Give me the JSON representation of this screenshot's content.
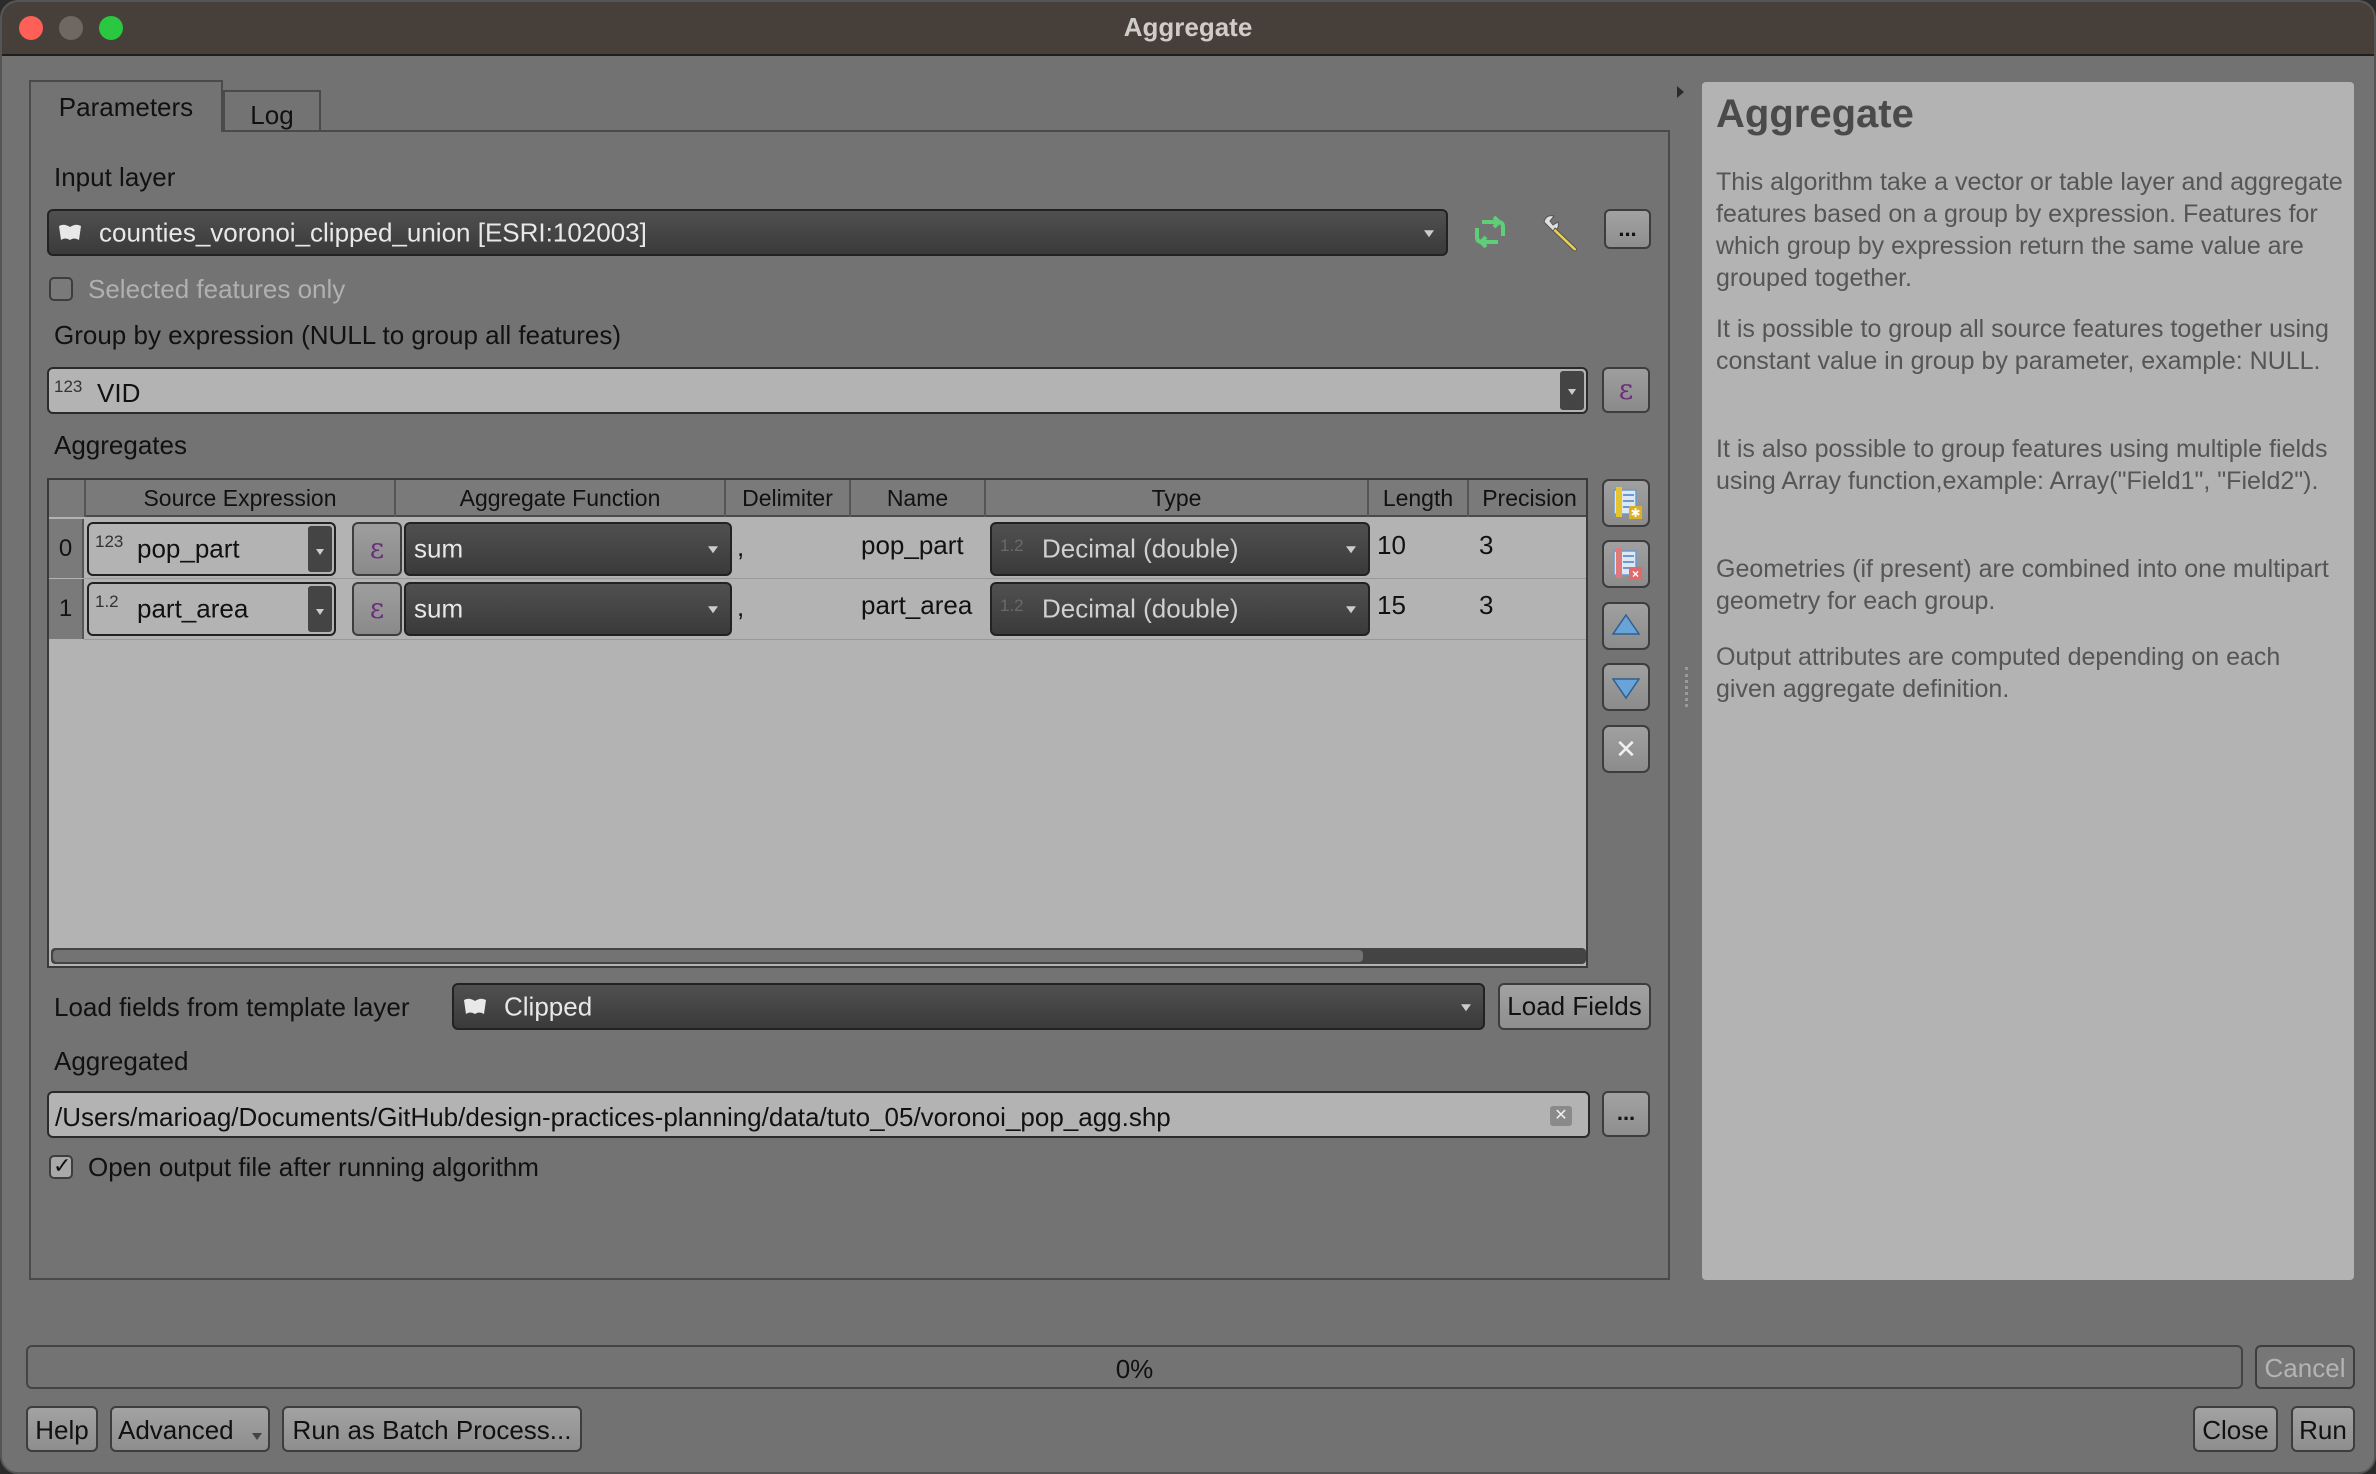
{
  "window": {
    "title": "Aggregate"
  },
  "tabs": [
    {
      "label": "Parameters",
      "active": true
    },
    {
      "label": "Log",
      "active": false
    }
  ],
  "params": {
    "input_layer_label": "Input layer",
    "input_layer_value": "counties_voronoi_clipped_union [ESRI:102003]",
    "selected_only_label": "Selected features only",
    "selected_only_checked": false,
    "group_by_label": "Group by expression (NULL to group all features)",
    "group_by_type_badge": "123",
    "group_by_value": "VID",
    "aggregates_label": "Aggregates",
    "load_fields_label": "Load fields from template layer",
    "template_layer_value": "Clipped",
    "load_fields_button": "Load Fields",
    "aggregated_label": "Aggregated",
    "output_path": "/Users/marioag/Documents/GitHub/design-practices-planning/data/tuto_05/voronoi_pop_agg.shp",
    "open_output_label": "Open output file after running algorithm",
    "open_output_checked": true,
    "browse_label": "..."
  },
  "table": {
    "columns": [
      "Source Expression",
      "Aggregate Function",
      "Delimiter",
      "Name",
      "Type",
      "Length",
      "Precision"
    ],
    "rows": [
      {
        "index": "0",
        "source_badge": "123",
        "source": "pop_part",
        "function": "sum",
        "delimiter": ",",
        "name": "pop_part",
        "type_badge": "1.2",
        "type": "Decimal (double)",
        "length": "10",
        "precision": "3"
      },
      {
        "index": "1",
        "source_badge": "1.2",
        "source": "part_area",
        "function": "sum",
        "delimiter": ",",
        "name": "part_area",
        "type_badge": "1.2",
        "type": "Decimal (double)",
        "length": "15",
        "precision": "3"
      }
    ],
    "expression_symbol": "ε"
  },
  "side_buttons": [
    "add-field-icon",
    "delete-field-icon",
    "move-up-icon",
    "move-down-icon",
    "clear-icon"
  ],
  "help": {
    "title": "Aggregate",
    "paragraphs": [
      "This algorithm take a vector or table layer and aggregate features based on a group by expression. Features for which group by expression return the same value are grouped together.",
      "It is possible to group all source features together using constant value in group by parameter, example: NULL.",
      "It is also possible to group features using multiple fields using Array function,example: Array(\"Field1\", \"Field2\").",
      "Geometries (if present) are combined into one multipart geometry for each group.",
      "Output attributes are computed depending on each given aggregate definition."
    ]
  },
  "progress": {
    "value_percent": 0,
    "text": "0%"
  },
  "buttons": {
    "cancel": "Cancel",
    "help": "Help",
    "advanced": "Advanced",
    "batch": "Run as Batch Process...",
    "close": "Close",
    "run": "Run"
  },
  "colors": {
    "titlebar": "#463f3a",
    "window_bg": "#727272",
    "help_panel": "#b3b3b3",
    "refresh_icon": "#5fce78",
    "expression_icon": "#6a2f7a"
  }
}
